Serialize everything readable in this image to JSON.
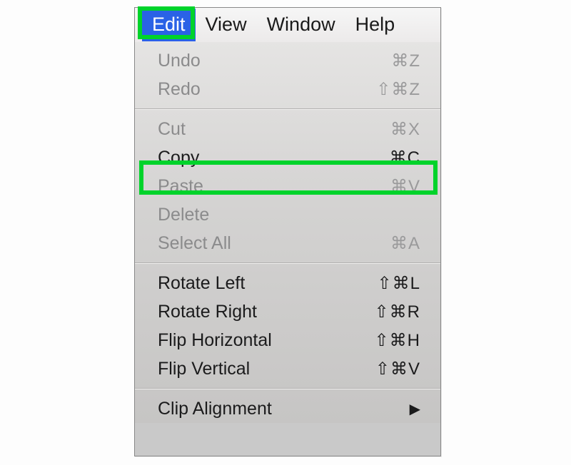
{
  "menubar": {
    "edit": "Edit",
    "view": "View",
    "window": "Window",
    "help": "Help"
  },
  "menu": {
    "undo": {
      "label": "Undo",
      "shortcut": "⌘Z"
    },
    "redo": {
      "label": "Redo",
      "shortcut": "⇧⌘Z"
    },
    "cut": {
      "label": "Cut",
      "shortcut": "⌘X"
    },
    "copy": {
      "label": "Copy",
      "shortcut": "⌘C"
    },
    "paste": {
      "label": "Paste",
      "shortcut": "⌘V"
    },
    "delete": {
      "label": "Delete",
      "shortcut": ""
    },
    "selectAll": {
      "label": "Select All",
      "shortcut": "⌘A"
    },
    "rotateLeft": {
      "label": "Rotate Left",
      "shortcut": "⇧⌘L"
    },
    "rotateRight": {
      "label": "Rotate Right",
      "shortcut": "⇧⌘R"
    },
    "flipHorizontal": {
      "label": "Flip Horizontal",
      "shortcut": "⇧⌘H"
    },
    "flipVertical": {
      "label": "Flip Vertical",
      "shortcut": "⇧⌘V"
    },
    "clipAlignment": {
      "label": "Clip Alignment",
      "arrow": "▶"
    }
  },
  "highlights": {
    "edit": "highlight-edit",
    "copy": "highlight-copy"
  }
}
